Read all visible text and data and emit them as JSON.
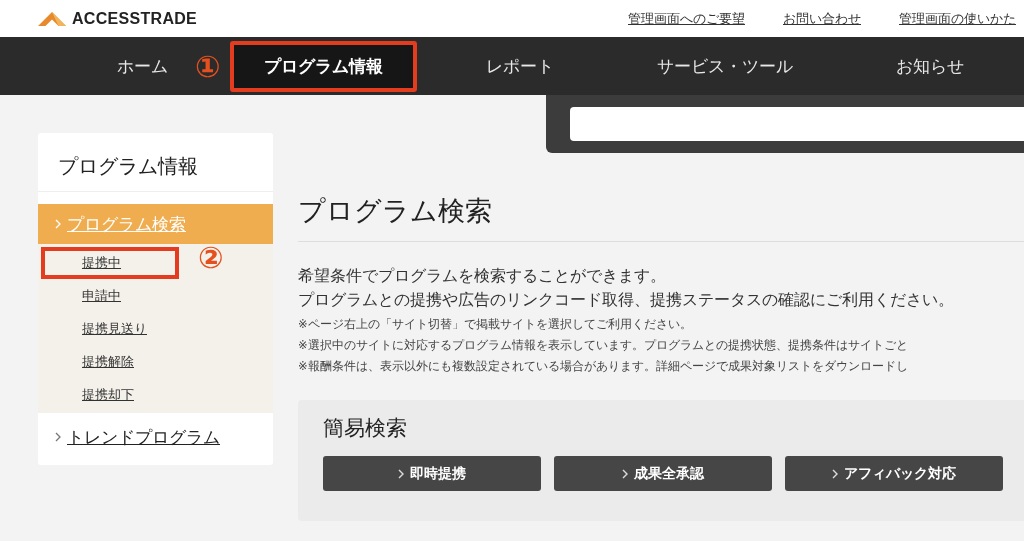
{
  "header": {
    "logo": "ACCESSTRADE",
    "links": [
      "管理画面へのご要望",
      "お問い合わせ",
      "管理画面の使いかた"
    ]
  },
  "nav": [
    {
      "label": "ホーム",
      "selected": false,
      "highlighted": false
    },
    {
      "label": "プログラム情報",
      "selected": true,
      "highlighted": true,
      "marker": "①"
    },
    {
      "label": "レポート",
      "selected": false,
      "highlighted": false
    },
    {
      "label": "サービス・ツール",
      "selected": false,
      "highlighted": false
    },
    {
      "label": "お知らせ",
      "selected": false,
      "highlighted": false
    }
  ],
  "sidebar": {
    "title": "プログラム情報",
    "items": [
      {
        "label": "プログラム検索",
        "selected": true,
        "children": [
          {
            "label": "提携中",
            "highlighted": true,
            "marker": "②"
          },
          {
            "label": "申請中",
            "highlighted": false
          },
          {
            "label": "提携見送り",
            "highlighted": false
          },
          {
            "label": "提携解除",
            "highlighted": false
          },
          {
            "label": "提携却下",
            "highlighted": false
          }
        ]
      },
      {
        "label": "トレンドプログラム",
        "selected": false
      }
    ]
  },
  "main": {
    "title": "プログラム検索",
    "intro": [
      "希望条件でプログラムを検索することができます。",
      "プログラムとの提携や広告のリンクコード取得、提携ステータスの確認にご利用ください。"
    ],
    "notes": [
      "※ページ右上の「サイト切替」で掲載サイトを選択してご利用ください。",
      "※選択中のサイトに対応するプログラム情報を表示しています。プログラムとの提携状態、提携条件はサイトごと",
      "※報酬条件は、表示以外にも複数設定されている場合があります。詳細ページで成果対象リストをダウンロードし"
    ],
    "quick_search": {
      "title": "簡易検索",
      "buttons": [
        "即時提携",
        "成果全承認",
        "アフィバック対応"
      ]
    }
  }
}
